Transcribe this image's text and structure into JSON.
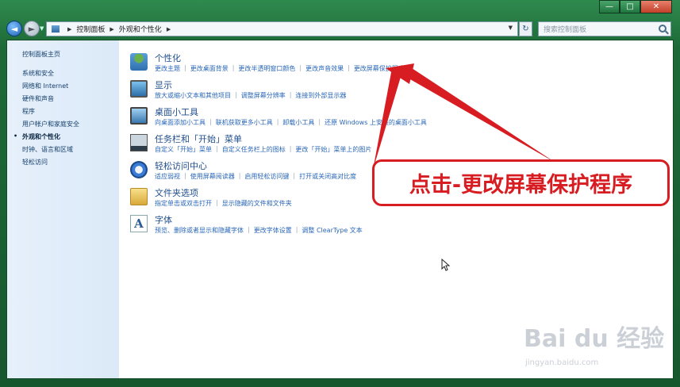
{
  "window": {
    "controls": {
      "minimize": "—",
      "maximize": "□",
      "close": "✕"
    }
  },
  "nav": {
    "back": "◄",
    "forward": "►",
    "breadcrumb": [
      "控制面板",
      "外观和个性化"
    ],
    "search_placeholder": "搜索控制面板"
  },
  "sidebar": {
    "home": "控制面板主页",
    "items": [
      "系统和安全",
      "网络和 Internet",
      "硬件和声音",
      "程序",
      "用户帐户和家庭安全",
      "外观和个性化",
      "时钟、语言和区域",
      "轻松访问"
    ],
    "active_index": 5
  },
  "categories": [
    {
      "title": "个性化",
      "icon": "personalization-icon",
      "links": [
        "更改主题",
        "更改桌面背景",
        "更改半透明窗口颜色",
        "更改声音效果",
        "更改屏幕保护程序"
      ]
    },
    {
      "title": "显示",
      "icon": "display-icon",
      "links": [
        "放大或缩小文本和其他项目",
        "调整屏幕分辨率",
        "连接到外部显示器"
      ]
    },
    {
      "title": "桌面小工具",
      "icon": "gadgets-icon",
      "links": [
        "向桌面添加小工具",
        "联机获取更多小工具",
        "卸载小工具",
        "还原 Windows 上安装的桌面小工具"
      ]
    },
    {
      "title": "任务栏和「开始」菜单",
      "icon": "taskbar-icon",
      "links": [
        "自定义「开始」菜单",
        "自定义任务栏上的图标",
        "更改「开始」菜单上的图片"
      ]
    },
    {
      "title": "轻松访问中心",
      "icon": "ease-of-access-icon",
      "links": [
        "适应弱视",
        "使用屏幕阅读器",
        "启用轻松访问键",
        "打开或关闭高对比度"
      ]
    },
    {
      "title": "文件夹选项",
      "icon": "folder-options-icon",
      "links": [
        "指定单击或双击打开",
        "显示隐藏的文件和文件夹"
      ]
    },
    {
      "title": "字体",
      "icon": "fonts-icon",
      "links": [
        "预览、删除或者显示和隐藏字体",
        "更改字体设置",
        "调整 ClearType 文本"
      ]
    }
  ],
  "annotation": {
    "callout_text": "点击-更改屏幕保护程序",
    "color": "#d71d22"
  },
  "watermark": {
    "main": "Bai du 经验",
    "sub": "jingyan.baidu.com"
  }
}
